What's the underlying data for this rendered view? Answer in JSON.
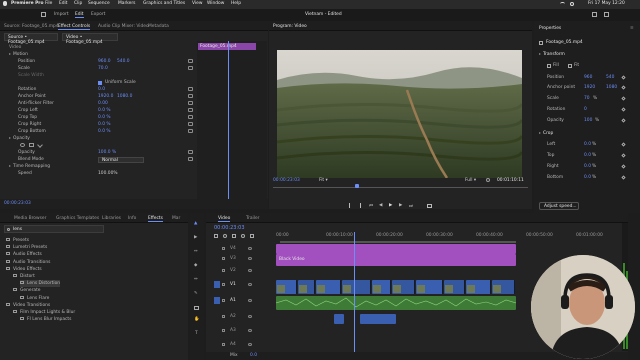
{
  "menubar": {
    "app_name": "Premiere Pro",
    "items": [
      "File",
      "Edit",
      "Clip",
      "Sequence",
      "Markers",
      "Graphics and Titles",
      "View",
      "Window",
      "Help"
    ],
    "clock": "Fri 17 May 12:20"
  },
  "workspace": {
    "tabs": [
      "Import",
      "Edit",
      "Export"
    ],
    "project_title": "Vietnam - Edited"
  },
  "source_panel": {
    "tabs": [
      "Source: Footage_05.mp4",
      "Effect Controls",
      "Audio Clip Mixer: Video",
      "Metadata"
    ],
    "clip_selector": "Source • Footage_05.mp4",
    "sequence_selector": "Video • Footage_05.mp4",
    "mini_clip_label": "Footage_05.mp4",
    "section_video": "Video",
    "motion": "Motion",
    "position_label": "Position",
    "position_x": "960.0",
    "position_y": "540.0",
    "scale_label": "Scale",
    "scale_value": "70.0",
    "scale_width_label": "Scale Width",
    "uniform_scale": "Uniform Scale",
    "rotation_label": "Rotation",
    "rotation_value": "0.0",
    "anchor_label": "Anchor Point",
    "anchor_x": "1920.0",
    "anchor_y": "1080.0",
    "flicker_label": "Anti-flicker Filter",
    "flicker_value": "0.00",
    "crop_left_label": "Crop Left",
    "crop_left_value": "0.0 %",
    "crop_top_label": "Crop Top",
    "crop_top_value": "0.0 %",
    "crop_right_label": "Crop Right",
    "crop_right_value": "0.0 %",
    "crop_bottom_label": "Crop Bottom",
    "crop_bottom_value": "0.0 %",
    "opacity_section": "Opacity",
    "opacity_label": "Opacity",
    "opacity_value": "100.0 %",
    "blend_label": "Blend Mode",
    "blend_value": "Normal",
    "time_remap": "Time Remapping",
    "speed_label": "Speed",
    "speed_value": "100.00%"
  },
  "program": {
    "label": "Program: Video",
    "timecode_current": "00:00:23:03",
    "fit": "Fit",
    "quality": "Full",
    "timecode_end": "00:01:10:11"
  },
  "properties": {
    "title": "Properties",
    "clip_name": "Footage_05.mp4",
    "transform": "Transform",
    "fill_label": "Fill",
    "fit_label": "Fit",
    "position_label": "Position",
    "position_x": "960",
    "position_y": "540",
    "anchor_label": "Anchor point",
    "anchor_x": "1920",
    "anchor_y": "1080",
    "scale_label": "Scale",
    "scale_value": "70",
    "rotation_label": "Rotation",
    "rotation_value": "0",
    "opacity_label": "Opacity",
    "opacity_value": "100",
    "crop": "Crop",
    "left_label": "Left",
    "left_value": "0.0",
    "top_label": "Top",
    "top_value": "0.0",
    "right_label": "Right",
    "right_value": "0.0",
    "bottom_label": "Bottom",
    "bottom_value": "0.0",
    "unit_pct": "%",
    "adjust_speed": "Adjust speed..."
  },
  "effects": {
    "tabs": [
      "Media Browser",
      "Graphics Templates",
      "Libraries",
      "Info",
      "Effects",
      "Mar"
    ],
    "search_value": "lens",
    "items": [
      {
        "label": "Presets",
        "level": 0
      },
      {
        "label": "Lumetri Presets",
        "level": 0
      },
      {
        "label": "Audio Effects",
        "level": 0
      },
      {
        "label": "Audio Transitions",
        "level": 0
      },
      {
        "label": "Video Effects",
        "level": 0
      },
      {
        "label": "Distort",
        "level": 1
      },
      {
        "label": "Lens Distortion",
        "level": 2
      },
      {
        "label": "Generate",
        "level": 1
      },
      {
        "label": "Lens Flare",
        "level": 2
      },
      {
        "label": "Video Transitions",
        "level": 0
      },
      {
        "label": "Film Impact Lights & Blur",
        "level": 1
      },
      {
        "label": "FI Lens Blur Impacts",
        "level": 2
      }
    ]
  },
  "timeline": {
    "tabs": [
      "Video",
      "Trailer"
    ],
    "timecode": "00:00:23:03",
    "ruler": [
      "00:00",
      "00:00:10:00",
      "00:00:20:00",
      "00:00:30:00",
      "00:00:40:00",
      "00:00:50:00",
      "00:01:00:00"
    ],
    "tracks": [
      "V4",
      "V3",
      "V2",
      "V1",
      "A1",
      "A2",
      "A3",
      "A4"
    ],
    "black_video_label": "Black Video",
    "mix_label": "Mix",
    "mix_value": "0.0"
  },
  "colors": {
    "accent": "#6c8ef7",
    "adjustment": "#a24fbf",
    "video_clip": "#3a5fb0",
    "audio_clip": "#3d7b36"
  }
}
